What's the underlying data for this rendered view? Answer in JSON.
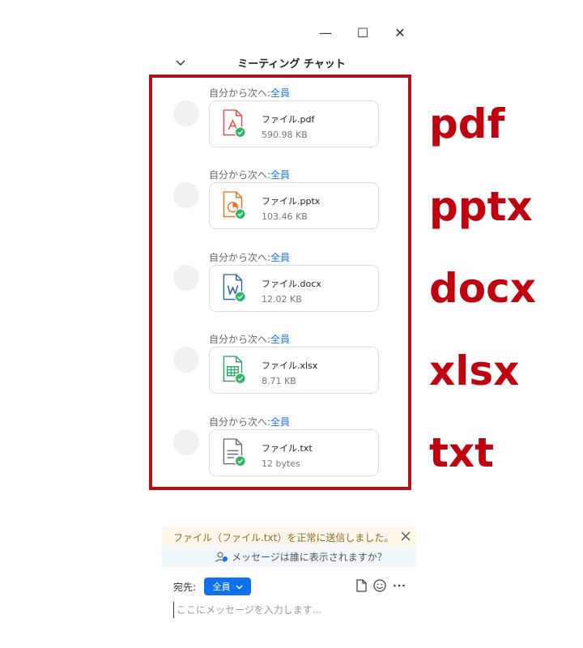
{
  "window": {
    "minimize_glyph": "—",
    "maximize_glyph": "☐",
    "close_glyph": "✕"
  },
  "header": {
    "title": "ミーティング チャット",
    "collapse_icon": "chevron-down-icon"
  },
  "messages": [
    {
      "sender": "自分から次へ:",
      "recipient": "全員",
      "file_name": "ファイル.pdf",
      "file_size": "590.98 KB",
      "file_type": "pdf",
      "icon_color": "#e8453c"
    },
    {
      "sender": "自分から次へ:",
      "recipient": "全員",
      "file_name": "ファイル.pptx",
      "file_size": "103.46 KB",
      "file_type": "pptx",
      "icon_color": "#f26b21"
    },
    {
      "sender": "自分から次へ:",
      "recipient": "全員",
      "file_name": "ファイル.docx",
      "file_size": "12.02 KB",
      "file_type": "docx",
      "icon_color": "#2b5fad"
    },
    {
      "sender": "自分から次へ:",
      "recipient": "全員",
      "file_name": "ファイル.xlsx",
      "file_size": "8.71 KB",
      "file_type": "xlsx",
      "icon_color": "#21a35a"
    },
    {
      "sender": "自分から次へ:",
      "recipient": "全員",
      "file_name": "ファイル.txt",
      "file_size": "12 bytes",
      "file_type": "txt",
      "icon_color": "#6b6b6b"
    }
  ],
  "annotations": {
    "labels": [
      "pdf",
      "pptx",
      "docx",
      "xlsx",
      "txt"
    ],
    "color": "#c0000f"
  },
  "notice": {
    "text": "ファイル（ファイル.txt）を正常に送信しました。"
  },
  "visibility": {
    "text": "メッセージは誰に表示されますか？"
  },
  "composer": {
    "to_label": "宛先:",
    "recipient": "全員",
    "placeholder": "ここにメッセージを入力します..."
  },
  "colors": {
    "accent": "#0e72ed",
    "link": "#1a73e8",
    "success": "#2cb566"
  }
}
